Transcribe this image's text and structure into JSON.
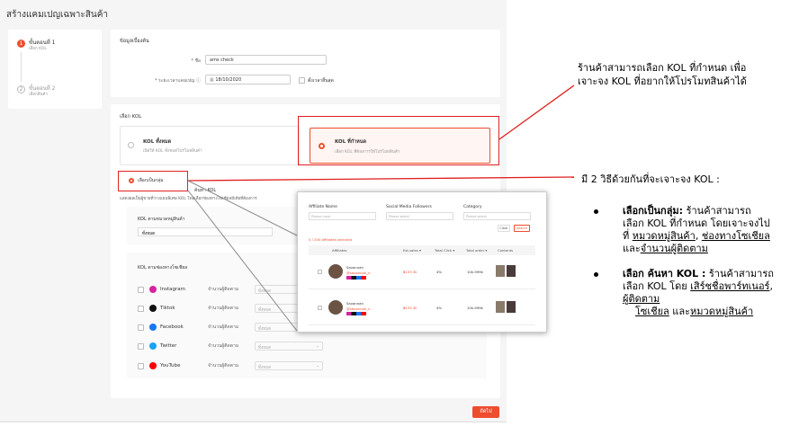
{
  "page": {
    "title": "สร้างแคมเปญเฉพาะสินค้า"
  },
  "steps": [
    {
      "num": "1",
      "title": "ขั้นตอนที่ 1",
      "sub": "เลือก KOL"
    },
    {
      "num": "2",
      "title": "ขั้นตอนที่ 2",
      "sub": "เลือกสินค้า"
    }
  ],
  "basic_info": {
    "heading": "ข้อมูลเบื้องต้น",
    "name_label": "* ชื่อ",
    "name_value": "ams check",
    "period_label": "* ระยะเวลาแคมเปญ ⓘ",
    "date_value": "18/10/2020",
    "no_end_label": "ตั้งเวลาสิ้นสุด"
  },
  "kol_select": {
    "heading": "เลือก KOL",
    "all_title": "KOL ทั้งหมด",
    "all_sub": "เปิดให้ KOL ทั้งหมดโปรโมทสินค้า",
    "specific_title": "KOL ที่กำหนด",
    "specific_sub": "เลือก KOL ที่ต้องการให้โปรโมทสินค้า",
    "tab_group": "เลือกเป็นกลุ่ม",
    "tab_search": "ค้นหา KOL",
    "group_desc": "แสดงผลเป็นผู้ขายที่วางแผนพิเศษ KOL โดยเลือกช่องทางโซเชียลมีเดียที่ต้องการ",
    "category_label": "KOL ตามหมวดหมู่สินค้า",
    "category_value": "ทั้งหมด",
    "social_heading": "KOL ตามช่องทางโซเชียล",
    "followers_label": "จำนวนผู้ติดตาม",
    "select_placeholder": "ทั้งหมด",
    "socials": [
      {
        "name": "Instagram",
        "icon": "instagram-icon",
        "color": "#d6249f"
      },
      {
        "name": "Tiktok",
        "icon": "tiktok-icon",
        "color": "#111111"
      },
      {
        "name": "Facebook",
        "icon": "facebook-icon",
        "color": "#1877f2"
      },
      {
        "name": "Twitter",
        "icon": "twitter-icon",
        "color": "#1da1f2"
      },
      {
        "name": "YouTube",
        "icon": "youtube-icon",
        "color": "#ff0000"
      }
    ]
  },
  "overlay": {
    "filter1_label": "Affiliate Name",
    "filter1_placeholder": "Please input",
    "filter2_label": "Social Media Followers",
    "filter2_placeholder": "Please select",
    "filter3_label": "Category",
    "filter3_placeholder": "Please select",
    "clear_label": "Clear",
    "search_label": "Search",
    "selected_text": "0 / 200 affiliates selected",
    "headers": [
      "Affiliates",
      "Est.sales ▾",
      "Total Click ▾",
      "Total order ▾",
      "Contents"
    ],
    "rows": [
      {
        "name": "Savannah",
        "handle": "@savannah_n",
        "sales": "฿133.3k",
        "click": "4%",
        "order": "10k-999k"
      },
      {
        "name": "Savannah",
        "handle": "@savannah_n",
        "sales": "฿133.3k",
        "click": "4%",
        "order": "10k-999k"
      }
    ]
  },
  "save_button": "ถัดไป",
  "annotations": {
    "top_line1": "ร้านค้าสามารถเลือก KOL ที่กำหนด เพื่อ",
    "top_line2": "เจาะจง KOL ที่อยากให้โปรโมทสินค้าได้",
    "mid_text": "มี 2 วิธีด้วยกันที่จะเจาะจง KOL :",
    "b1_bold": "เลือกเป็นกลุ่ม:",
    "b1_text1": " ร้านค้าสามารถ",
    "b1_text2": "เลือก KOL ที่กำหนด โดยเจาะจงไป",
    "b1_text3": "ที่ ",
    "b1_u1": "หมวดหมู่สินค้า",
    "b1_sep1": ", ",
    "b1_u2": "ช่องทางโซเชียล",
    "b1_text4": "และ",
    "b1_u3": "จำนวนผู้ติดตาม",
    "b2_bold": "เลือก ค้นหา KOL :",
    "b2_text1": " ร้านค้าสามารถ",
    "b2_text2": "เลือก KOL โดย ",
    "b2_u1": "เสิร์ชชื่อพาร์ทเนอร์",
    "b2_sep": ",",
    "b2_u2": "ผู้ติดตาม",
    "b2_u3": "โซเชียล",
    "b2_text3": " และ",
    "b2_u4": "หมวดหมู่สินค้า"
  },
  "colors": {
    "accent": "#ee4d2d",
    "highlight": "#e02020"
  }
}
